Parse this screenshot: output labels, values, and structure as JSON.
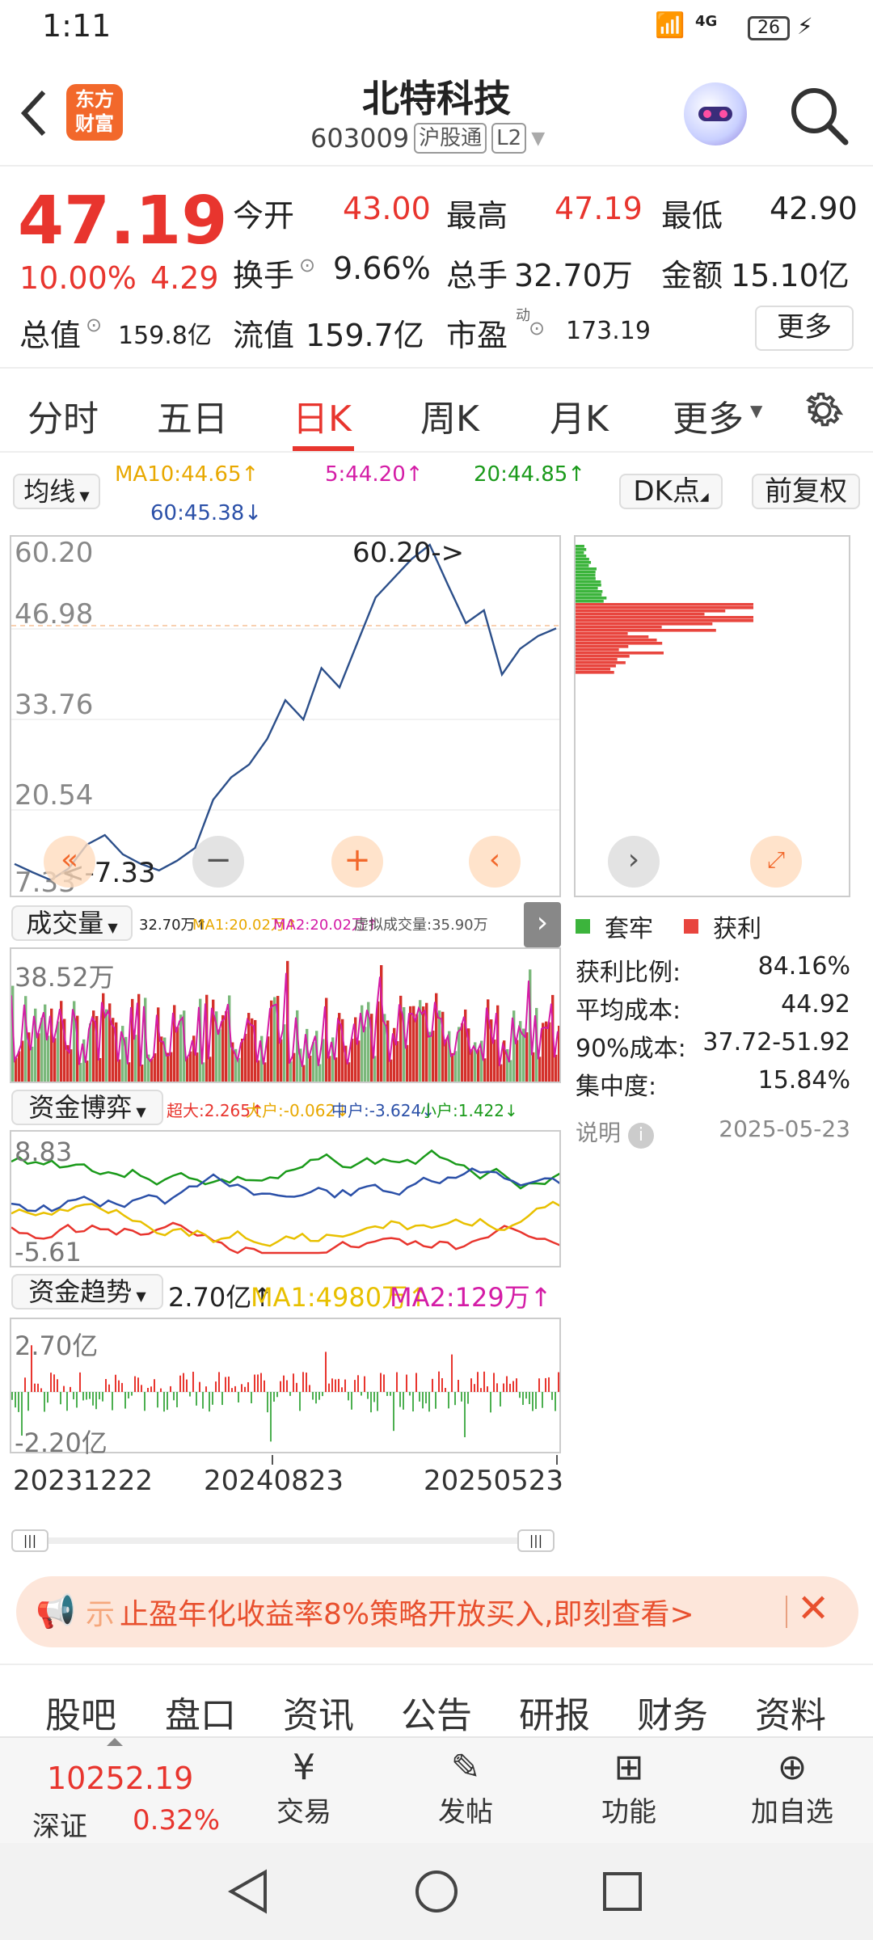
{
  "status": {
    "time": "1:11",
    "network": "4G",
    "battery": "26"
  },
  "header": {
    "title": "北特科技",
    "code": "603009",
    "tag_market": "沪股通",
    "tag_level": "L2",
    "logo_line1": "东方",
    "logo_line2": "财富"
  },
  "quote": {
    "price": "47.19",
    "change_pct": "10.00%",
    "change": "4.29",
    "open_label": "今开",
    "open": "43.00",
    "high_label": "最高",
    "high": "47.19",
    "low_label": "最低",
    "low": "42.90",
    "turnover_label": "换手",
    "turnover": "9.66%",
    "volume_label": "总手",
    "volume": "32.70万",
    "amount_label": "金额",
    "amount": "15.10亿",
    "mktcap_label": "总值",
    "mktcap": "159.8亿",
    "float_label": "流值",
    "float_cap": "159.7亿",
    "pe_label": "市盈",
    "pe_sup": "动",
    "pe": "173.19",
    "more_button": "更多"
  },
  "tabs": [
    "分时",
    "五日",
    "日K",
    "周K",
    "月K",
    "更多"
  ],
  "chart_controls": {
    "ma_selector": "均线",
    "ma10": "MA10:44.65↑",
    "ma5": "5:44.20↑",
    "ma20": "20:44.85↑",
    "ma60": "60:45.38↓",
    "dk_button": "DK点",
    "fq_button": "前复权"
  },
  "main_chart": {
    "y_ticks": [
      "60.20",
      "46.98",
      "33.76",
      "20.54",
      "7.33"
    ],
    "high_annotation": "60.20->",
    "low_annotation": "<-7.33"
  },
  "volume_panel": {
    "selector": "成交量",
    "legend": "32.70万↑",
    "ma1": "MA1:20.02万↑",
    "ma2": "MA2:20.02万↑",
    "virtual": "虚拟成交量:35.90万",
    "y_top": "38.52万"
  },
  "fund_game_panel": {
    "selector": "资金博弈",
    "super": "超大:2.265↑",
    "big": "大户:-0.062↓",
    "mid": "中户:-3.624↓",
    "small": "小户:1.422↓",
    "y_top": "8.83",
    "y_bottom": "-5.61"
  },
  "fund_trend_panel": {
    "selector": "资金趋势",
    "value": "2.70亿↑",
    "ma1": "MA1:4980万↑",
    "ma2": "MA2:129万↑",
    "y_top": "2.70亿",
    "y_bottom": "-2.20亿"
  },
  "x_dates": [
    "20231222",
    "20240823",
    "20250523"
  ],
  "chip": {
    "legend_trapped": "套牢",
    "legend_profit": "获利",
    "stats": [
      {
        "label": "获利比例:",
        "value": "84.16%"
      },
      {
        "label": "平均成本:",
        "value": "44.92"
      },
      {
        "label": "90%成本:",
        "value": "37.72-51.92"
      },
      {
        "label": "集中度:",
        "value": "15.84%"
      }
    ],
    "explain": "说明",
    "date": "2025-05-23"
  },
  "banner": {
    "text": "止盈年化收益率8%策略开放买入,即刻查看>",
    "prefix": "示"
  },
  "bottom_tabs": [
    "股吧",
    "盘口",
    "资讯",
    "公告",
    "研报",
    "财务",
    "资料"
  ],
  "bottom_nav": {
    "index_value": "10252.19",
    "index_name": "深证",
    "index_pct": "0.32%",
    "trade": "交易",
    "post": "发帖",
    "func": "功能",
    "add": "加自选"
  },
  "colors": {
    "up": "#e8352e",
    "down": "#1a9a1a",
    "accent": "#f2682b",
    "price_line": "#2c4f8a"
  },
  "chart_data": [
    {
      "type": "line",
      "title": "日K",
      "x": [
        "20231222",
        "20240823",
        "20250523"
      ],
      "series": [
        {
          "values": [
            10.5,
            9.2,
            8.0,
            9.8,
            13.5,
            15.0,
            12.0,
            10.5,
            9.5,
            11.0,
            13.0,
            20.5,
            24.0,
            26.0,
            30.0,
            36.0,
            33.0,
            41.0,
            38.0,
            45.0,
            52.0,
            55.0,
            58.0,
            60.2,
            54.0,
            48.0,
            50.0,
            40.0,
            44.0,
            46.0,
            47.19
          ]
        }
      ],
      "ylim": [
        7.33,
        60.2
      ],
      "high": 60.2,
      "low": 7.33
    }
  ]
}
